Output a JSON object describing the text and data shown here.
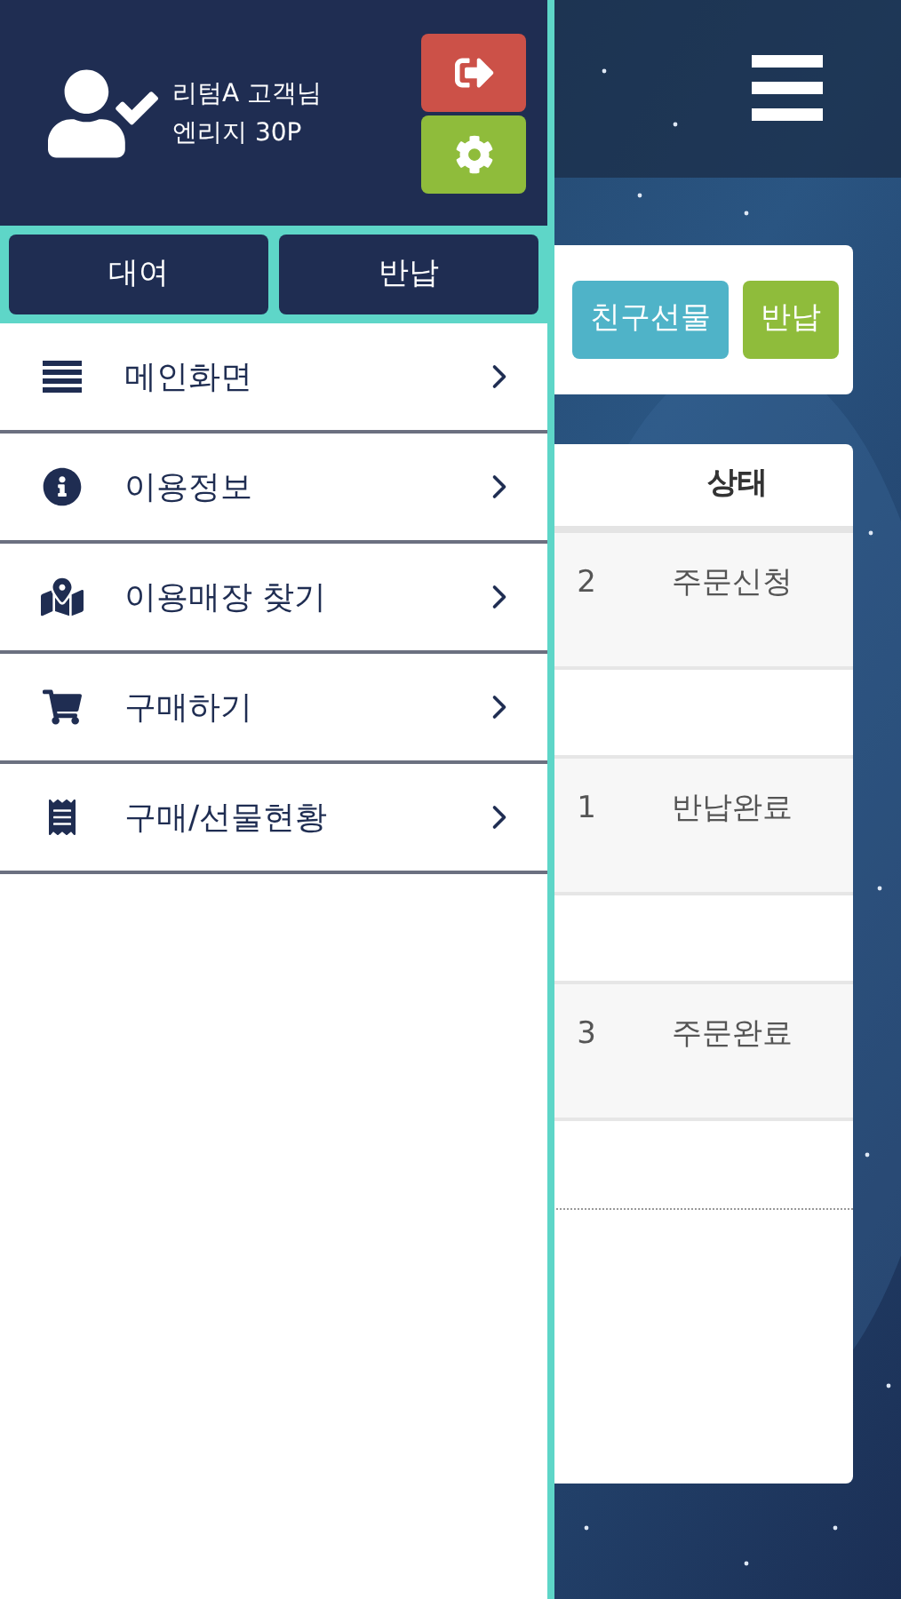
{
  "drawer": {
    "user": {
      "name": "리텀A 고객님",
      "points": "엔리지 30P"
    },
    "tabs": [
      {
        "label": "대여"
      },
      {
        "label": "반납"
      }
    ],
    "menu": [
      {
        "label": "메인화면"
      },
      {
        "label": "이용정보"
      },
      {
        "label": "이용매장 찾기"
      },
      {
        "label": "구매하기"
      },
      {
        "label": "구매/선물현황"
      }
    ]
  },
  "actions": [
    {
      "label": "친구선물",
      "color": "#4fb3c8"
    },
    {
      "label": "반납",
      "color": "#8fbc3b"
    }
  ],
  "table": {
    "columns": [
      "상태"
    ],
    "rows": [
      {
        "column_1": "2",
        "status": "주문신청"
      },
      {
        "column_1": "1",
        "status": "반납완료"
      },
      {
        "column_1": "3",
        "status": "주문완료"
      }
    ]
  }
}
